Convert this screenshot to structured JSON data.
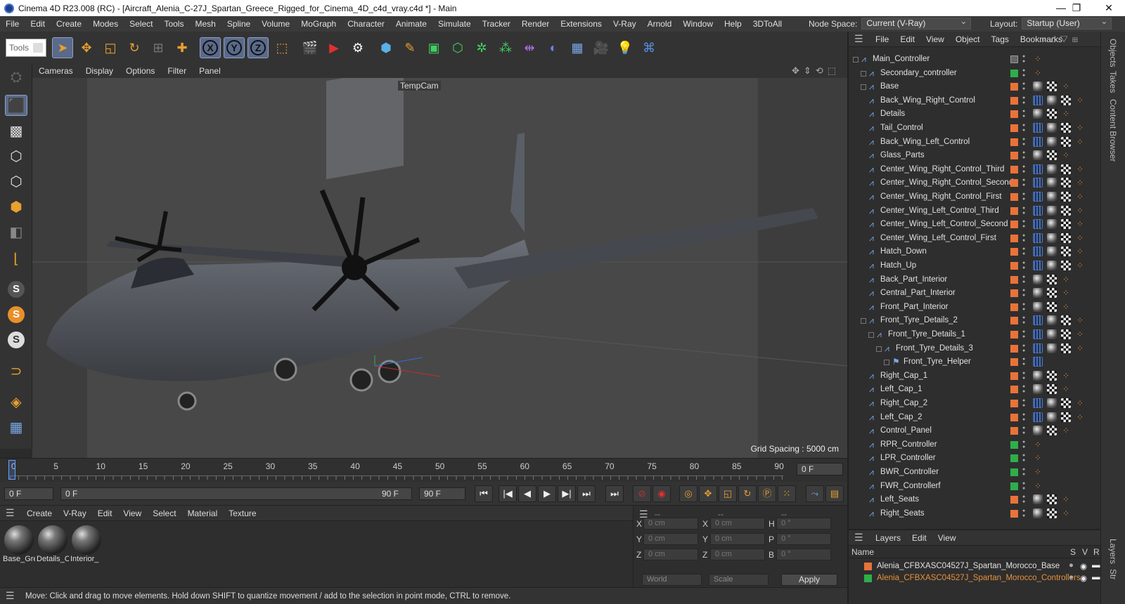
{
  "window": {
    "title": "Cinema 4D R23.008 (RC) - [Aircraft_Alenia_C-27J_Spartan_Greece_Rigged_for_Cinema_4D_c4d_vray.c4d *] - Main",
    "minimize": "—",
    "maximize": "❐",
    "close": "✕"
  },
  "menu": [
    "File",
    "Edit",
    "Create",
    "Modes",
    "Select",
    "Tools",
    "Mesh",
    "Spline",
    "Volume",
    "MoGraph",
    "Character",
    "Animate",
    "Simulate",
    "Tracker",
    "Render",
    "Extensions",
    "V-Ray",
    "Arnold",
    "Window",
    "Help",
    "3DToAll"
  ],
  "node_space": {
    "label": "Node Space:",
    "value": "Current (V-Ray)"
  },
  "layout": {
    "label": "Layout:",
    "value": "Startup (User)"
  },
  "toolbar": {
    "tools_label": "Tools",
    "x_label": "X",
    "y_label": "Y",
    "z_label": "Z"
  },
  "viewport": {
    "menu": [
      "Cameras",
      "Display",
      "Options",
      "Filter",
      "Panel"
    ],
    "camera": "TempCam",
    "grid_spacing": "Grid Spacing : 5000 cm"
  },
  "timeline": {
    "ticks": [
      "0",
      "5",
      "10",
      "15",
      "20",
      "25",
      "30",
      "35",
      "40",
      "45",
      "50",
      "55",
      "60",
      "65",
      "70",
      "75",
      "80",
      "85",
      "90"
    ],
    "current_frame": "0 F",
    "start_frame": "0 F",
    "range_start": "0 F",
    "range_end": "90 F",
    "end_frame": "90 F",
    "max_frame": "0 F"
  },
  "materials": {
    "menu": [
      "Create",
      "V-Ray",
      "Edit",
      "View",
      "Select",
      "Material",
      "Texture"
    ],
    "items": [
      "Base_Gre",
      "Details_C",
      "Interior_"
    ]
  },
  "coords": {
    "header1": "--",
    "header2": "--",
    "header3": "--",
    "rows": [
      {
        "a": "X",
        "av": "0 cm",
        "b": "X",
        "bv": "0 cm",
        "c": "H",
        "cv": "0 °"
      },
      {
        "a": "Y",
        "av": "0 cm",
        "b": "Y",
        "bv": "0 cm",
        "c": "P",
        "cv": "0 °"
      },
      {
        "a": "Z",
        "av": "0 cm",
        "b": "Z",
        "bv": "0 cm",
        "c": "B",
        "cv": "0 °"
      }
    ],
    "world": "World",
    "scale": "Scale",
    "apply": "Apply"
  },
  "status": "Move: Click and drag to move elements. Hold down SHIFT to quantize movement / add to the selection in point mode, CTRL to remove.",
  "objects": {
    "menu": [
      "File",
      "Edit",
      "View",
      "Object",
      "Tags",
      "Bookmarks"
    ],
    "colors": {
      "orange": "#e8733a",
      "green": "#2fae4a",
      "gray": "#888888"
    },
    "items": [
      {
        "name": "Main_Controller",
        "depth": 0,
        "layer": "gray",
        "tags": "o"
      },
      {
        "name": "Secondary_controller",
        "depth": 1,
        "layer": "green",
        "tags": "o"
      },
      {
        "name": "Base",
        "depth": 1,
        "layer": "orange",
        "tags": "pco"
      },
      {
        "name": "Back_Wing_Right_Control",
        "depth": 1,
        "layer": "orange",
        "tags": "bpco"
      },
      {
        "name": "Details",
        "depth": 1,
        "layer": "orange",
        "tags": "pco"
      },
      {
        "name": "Tail_Control",
        "depth": 1,
        "layer": "orange",
        "tags": "bpco"
      },
      {
        "name": "Back_Wing_Left_Control",
        "depth": 1,
        "layer": "orange",
        "tags": "bpco"
      },
      {
        "name": "Glass_Parts",
        "depth": 1,
        "layer": "orange",
        "tags": "pco"
      },
      {
        "name": "Center_Wing_Right_Control_Third",
        "depth": 1,
        "layer": "orange",
        "tags": "bpco"
      },
      {
        "name": "Center_Wing_Right_Control_Second",
        "depth": 1,
        "layer": "orange",
        "tags": "bpco"
      },
      {
        "name": "Center_Wing_Right_Control_First",
        "depth": 1,
        "layer": "orange",
        "tags": "bpco"
      },
      {
        "name": "Center_Wing_Left_Control_Third",
        "depth": 1,
        "layer": "orange",
        "tags": "bpco"
      },
      {
        "name": "Center_Wing_Left_Control_Second",
        "depth": 1,
        "layer": "orange",
        "tags": "bpco"
      },
      {
        "name": "Center_Wing_Left_Control_First",
        "depth": 1,
        "layer": "orange",
        "tags": "bpco"
      },
      {
        "name": "Hatch_Down",
        "depth": 1,
        "layer": "orange",
        "tags": "bpco"
      },
      {
        "name": "Hatch_Up",
        "depth": 1,
        "layer": "orange",
        "tags": "bpco"
      },
      {
        "name": "Back_Part_Interior",
        "depth": 1,
        "layer": "orange",
        "tags": "pco"
      },
      {
        "name": "Central_Part_Interior",
        "depth": 1,
        "layer": "orange",
        "tags": "pco"
      },
      {
        "name": "Front_Part_Interior",
        "depth": 1,
        "layer": "orange",
        "tags": "pco"
      },
      {
        "name": "Front_Tyre_Details_2",
        "depth": 1,
        "layer": "orange",
        "tags": "bpco"
      },
      {
        "name": "Front_Tyre_Details_1",
        "depth": 2,
        "layer": "orange",
        "tags": "bpco"
      },
      {
        "name": "Front_Tyre_Details_3",
        "depth": 3,
        "layer": "orange",
        "tags": "bpco"
      },
      {
        "name": "Front_Tyre_Helper",
        "depth": 4,
        "layer": "orange",
        "tags": "b"
      },
      {
        "name": "Right_Cap_1",
        "depth": 1,
        "layer": "orange",
        "tags": "pco"
      },
      {
        "name": "Left_Cap_1",
        "depth": 1,
        "layer": "orange",
        "tags": "pco"
      },
      {
        "name": "Right_Cap_2",
        "depth": 1,
        "layer": "orange",
        "tags": "bpco"
      },
      {
        "name": "Left_Cap_2",
        "depth": 1,
        "layer": "orange",
        "tags": "bpco"
      },
      {
        "name": "Control_Panel",
        "depth": 1,
        "layer": "orange",
        "tags": "pco"
      },
      {
        "name": "RPR_Controller",
        "depth": 1,
        "layer": "green",
        "tags": "o"
      },
      {
        "name": "LPR_Controller",
        "depth": 1,
        "layer": "green",
        "tags": "o"
      },
      {
        "name": "BWR_Controller",
        "depth": 1,
        "layer": "green",
        "tags": "o"
      },
      {
        "name": "FWR_Controllerf",
        "depth": 1,
        "layer": "green",
        "tags": "o"
      },
      {
        "name": "Left_Seats",
        "depth": 1,
        "layer": "orange",
        "tags": "pco"
      },
      {
        "name": "Right_Seats",
        "depth": 1,
        "layer": "orange",
        "tags": "pco"
      }
    ]
  },
  "layers": {
    "menu": [
      "Layers",
      "Edit",
      "View"
    ],
    "col_name": "Name",
    "col_s": "S",
    "col_v": "V",
    "col_r": "R",
    "items": [
      {
        "name": "Alenia_CFBXASC04527J_Spartan_Morocco_Base",
        "color": "#e8733a",
        "text_color": "#e0e0e0"
      },
      {
        "name": "Alenia_CFBXASC04527J_Spartan_Morocco_Controllers",
        "color": "#2fae4a",
        "text_color": "#e8903a"
      }
    ]
  },
  "side_tabs": [
    "Objects",
    "Takes",
    "Content Browser",
    "Layers",
    "Str"
  ]
}
